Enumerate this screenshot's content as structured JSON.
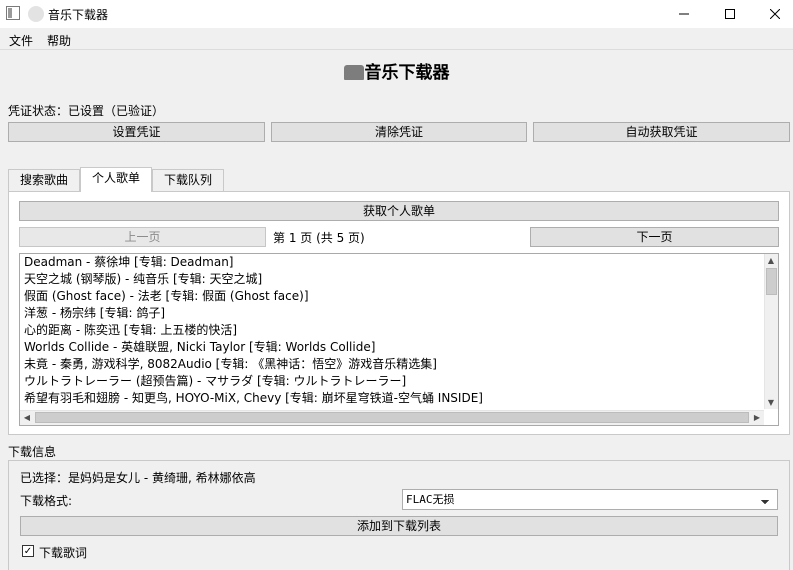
{
  "window": {
    "title": "音乐下载器",
    "controls": {
      "minimize": "—",
      "maximize": "☐",
      "close": "✕"
    }
  },
  "menu": {
    "items": [
      "文件",
      "帮助"
    ]
  },
  "header": {
    "title": "音乐下载器",
    "icon": "folder-icon"
  },
  "credentials": {
    "status": "凭证状态：已设置（已验证）",
    "set_label": "设置凭证",
    "clear_label": "清除凭证",
    "auto_label": "自动获取凭证"
  },
  "tabs": [
    {
      "label": "搜索歌曲",
      "active": false
    },
    {
      "label": "个人歌单",
      "active": true
    },
    {
      "label": "下载队列",
      "active": false
    }
  ],
  "playlist": {
    "fetch_label": "获取个人歌单",
    "prev_label": "上一页",
    "next_label": "下一页",
    "page_info": "第 1 页 (共 5 页)",
    "songs": [
      "Deadman - 蔡徐坤 [专辑: Deadman]",
      "天空之城 (钢琴版) - 纯音乐 [专辑: 天空之城]",
      "假面 (Ghost face) - 法老 [专辑: 假面 (Ghost face)]",
      "洋葱 - 杨宗纬 [专辑: 鸽子]",
      "心的距离 - 陈奕迅 [专辑: 上五楼的快活]",
      "Worlds Collide - 英雄联盟, Nicki Taylor [专辑: Worlds Collide]",
      "未竟 - 秦勇, 游戏科学, 8082Audio [专辑: 《黑神话：悟空》游戏音乐精选集]",
      "ウルトラトレーラー (超预告篇) - マサラダ [专辑: ウルトラトレーラー]",
      "希望有羽毛和翅膀 - 知更鸟, HOYO-MiX, Chevy [专辑: 崩坏星穹铁道-空气蛹 INSIDE]"
    ],
    "scroll_up": "▲",
    "scroll_down": "▼",
    "scroll_left": "◀",
    "scroll_right": "▶"
  },
  "download": {
    "section_label": "下载信息",
    "selected": "已选择：是妈妈是女儿 - 黄绮珊, 希林娜依高",
    "format_label": "下载格式:",
    "format_value": "FLAC无损",
    "add_label": "添加到下载列表",
    "lyrics_label": "下载歌词",
    "lyrics_checked": true
  }
}
